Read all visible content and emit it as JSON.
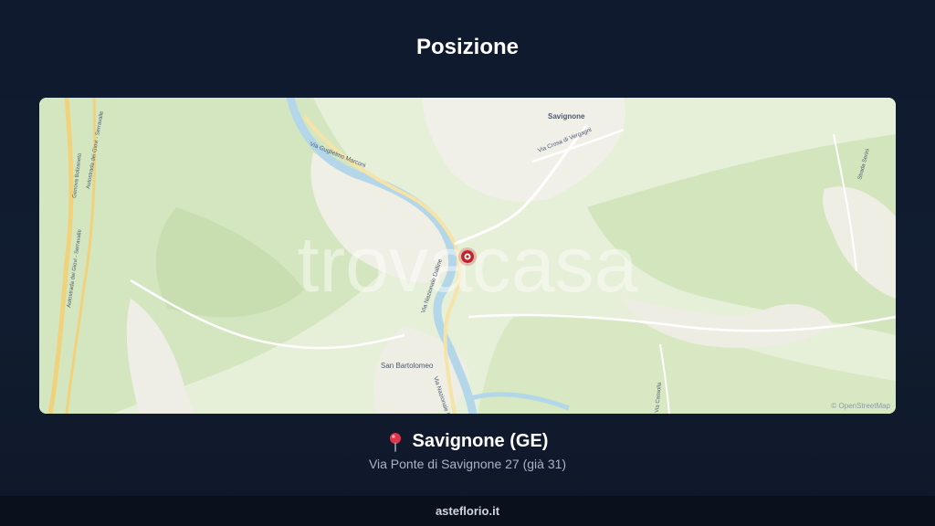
{
  "page": {
    "title": "Posizione"
  },
  "map": {
    "watermark": "trovacasa",
    "attribution": "© OpenStreetMap",
    "labels": {
      "savignone": "Savignone",
      "via_crosa": "Via Crosa di Vergagni",
      "via_marconi": "Via Guglielmo Marconi",
      "via_negli_alpini": "Via degli Alpini",
      "via_nazionale": "Via Nazionale Dalline",
      "via_nazionale2": "Via Nazionale Dalline",
      "san_bartolomeo": "San Bartolomeo",
      "autostrada1": "Autostrada dei Giovi - Serravalle",
      "autostrada2": "Autostrada dei Giovi - Serravalle",
      "autostrada3": "Genova Bolzaneto",
      "savi_right": "Strada Serini",
      "via_bottom_right": "Via Cassolla"
    },
    "marker_icon": "map-pin-icon",
    "colors": {
      "land": "#e6efd8",
      "forest": "#cfe3b8",
      "urban": "#f1f0e8",
      "river": "#b5d8e8",
      "road_major": "#f3d98b",
      "marker": "#c0242b"
    }
  },
  "location": {
    "pin_icon": "pushpin-icon",
    "name": "Savignone (GE)",
    "address": "Via Ponte di Savignone 27 (già 31)"
  },
  "footer": {
    "site": "asteflorio.it"
  }
}
